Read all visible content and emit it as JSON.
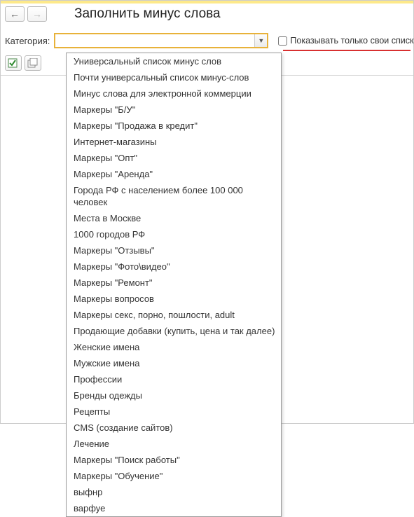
{
  "header": {
    "title": "Заполнить минус слова"
  },
  "category": {
    "label": "Категория:",
    "value": "",
    "placeholder": ""
  },
  "checkbox": {
    "label": "Показывать только свои списки",
    "checked": false
  },
  "dropdown": {
    "items": [
      "Универсальный список минус слов",
      "Почти универсальный список минус-слов",
      "Минус слова для электронной коммерции",
      "Маркеры \"Б/У\"",
      "Маркеры \"Продажа в кредит\"",
      "Интернет-магазины",
      "Маркеры \"Опт\"",
      "Маркеры \"Аренда\"",
      "Города РФ с населением более 100 000 человек",
      "Места в Москве",
      "1000 городов РФ",
      "Маркеры \"Отзывы\"",
      "Маркеры \"Фото\\видео\"",
      "Маркеры \"Ремонт\"",
      "Маркеры вопросов",
      "Маркеры секс, порно, пошлости, adult",
      "Продающие добавки (купить, цена и так далее)",
      "Женские имена",
      "Мужские имена",
      "Профессии",
      "Бренды одежды",
      "Рецепты",
      "CMS (создание сайтов)",
      "Лечение",
      "Маркеры \"Поиск работы\"",
      "Маркеры \"Обучение\"",
      "выфнр",
      "варфуе"
    ]
  }
}
